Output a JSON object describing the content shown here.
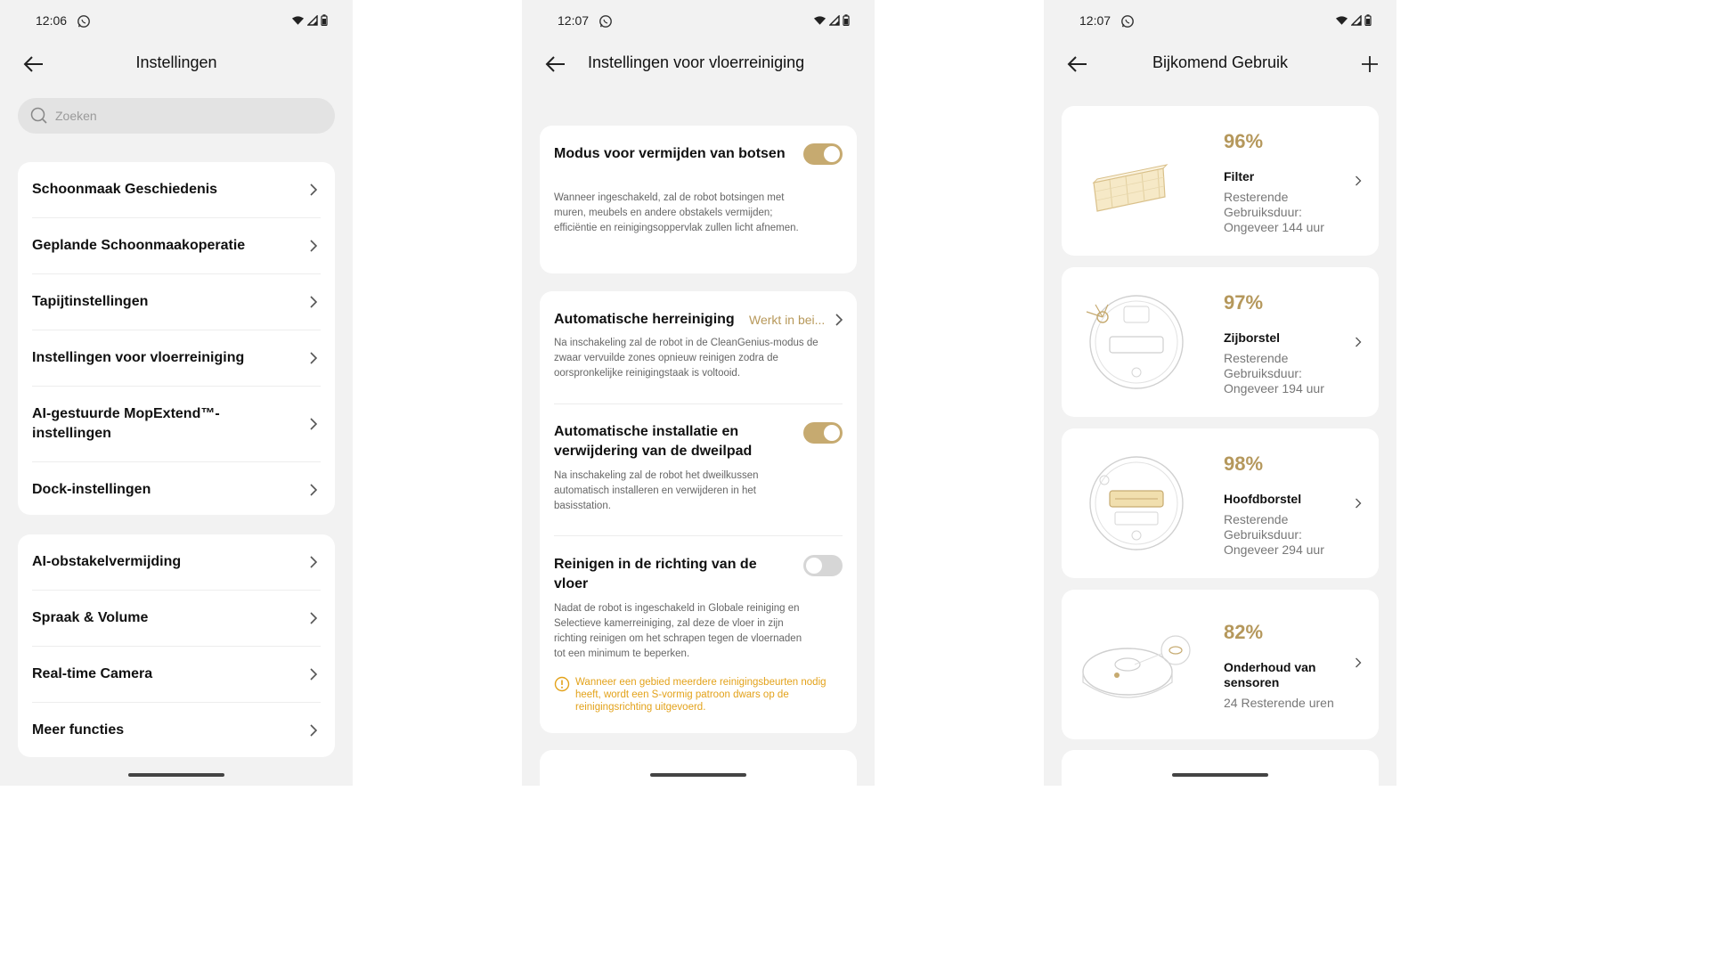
{
  "phone1": {
    "time": "12:06",
    "title": "Instellingen",
    "search_placeholder": "Zoeken",
    "group1": [
      {
        "label": "Schoonmaak Geschiedenis"
      },
      {
        "label": "Geplande Schoonmaakoperatie"
      },
      {
        "label": "Tapijtinstellingen"
      },
      {
        "label": "Instellingen voor vloerreiniging"
      },
      {
        "label": "AI-gestuurde MopExtend™-instellingen"
      },
      {
        "label": "Dock-instellingen"
      }
    ],
    "group2": [
      {
        "label": "AI-obstakelvermijding"
      },
      {
        "label": "Spraak & Volume"
      },
      {
        "label": "Real-time Camera"
      },
      {
        "label": "Meer functies"
      }
    ]
  },
  "phone2": {
    "time": "12:07",
    "title": "Instellingen voor vloerreiniging",
    "collision": {
      "title": "Modus voor vermijden van botsen",
      "desc": "Wanneer ingeschakeld, zal de robot botsingen met muren, meubels en andere obstakels vermijden; efficiëntie en reinigingsoppervlak zullen licht afnemen.",
      "enabled": true
    },
    "recleaning": {
      "title": "Automatische herreiniging",
      "value": "Werkt in bei...",
      "desc": "Na inschakeling zal de robot in de CleanGenius-modus de zwaar vervuilde zones opnieuw reinigen zodra de oorspronkelijke reinigingstaak is voltooid."
    },
    "mop_install": {
      "title": "Automatische installatie en verwijdering van de dweilpad",
      "desc": "Na inschakeling zal de robot het dweilkussen automatisch installeren en verwijderen in het basisstation.",
      "enabled": true
    },
    "floor_direction": {
      "title": "Reinigen in de richting van de vloer",
      "desc": "Nadat de robot is ingeschakeld in Globale reiniging en Selectieve kamerreiniging, zal deze de vloer in zijn richting reinigen om het schrapen tegen de vloernaden tot een minimum te beperken.",
      "enabled": false,
      "warning": "Wanneer een gebied meerdere reinigingsbeurten nodig heeft, wordt een S-vormig patroon dwars op de reinigingsrichting uitgevoerd."
    }
  },
  "phone3": {
    "time": "12:07",
    "title": "Bijkomend Gebruik",
    "items": [
      {
        "percent": "96%",
        "name": "Filter",
        "desc": "Resterende Gebruiksduur: Ongeveer 144 uur",
        "icon": "filter-image"
      },
      {
        "percent": "97%",
        "name": "Zijborstel",
        "desc": "Resterende Gebruiksduur: Ongeveer 194 uur",
        "icon": "side-brush-image"
      },
      {
        "percent": "98%",
        "name": "Hoofdborstel",
        "desc": "Resterende Gebruiksduur: Ongeveer 294 uur",
        "icon": "main-brush-image"
      },
      {
        "percent": "82%",
        "name": "Onderhoud van sensoren",
        "desc": "24 Resterende uren",
        "icon": "sensor-image"
      }
    ]
  },
  "colors": {
    "accent": "#c6aa70",
    "percent": "#b5985c",
    "warning": "#e3a21a",
    "background": "#f2f2f2"
  }
}
